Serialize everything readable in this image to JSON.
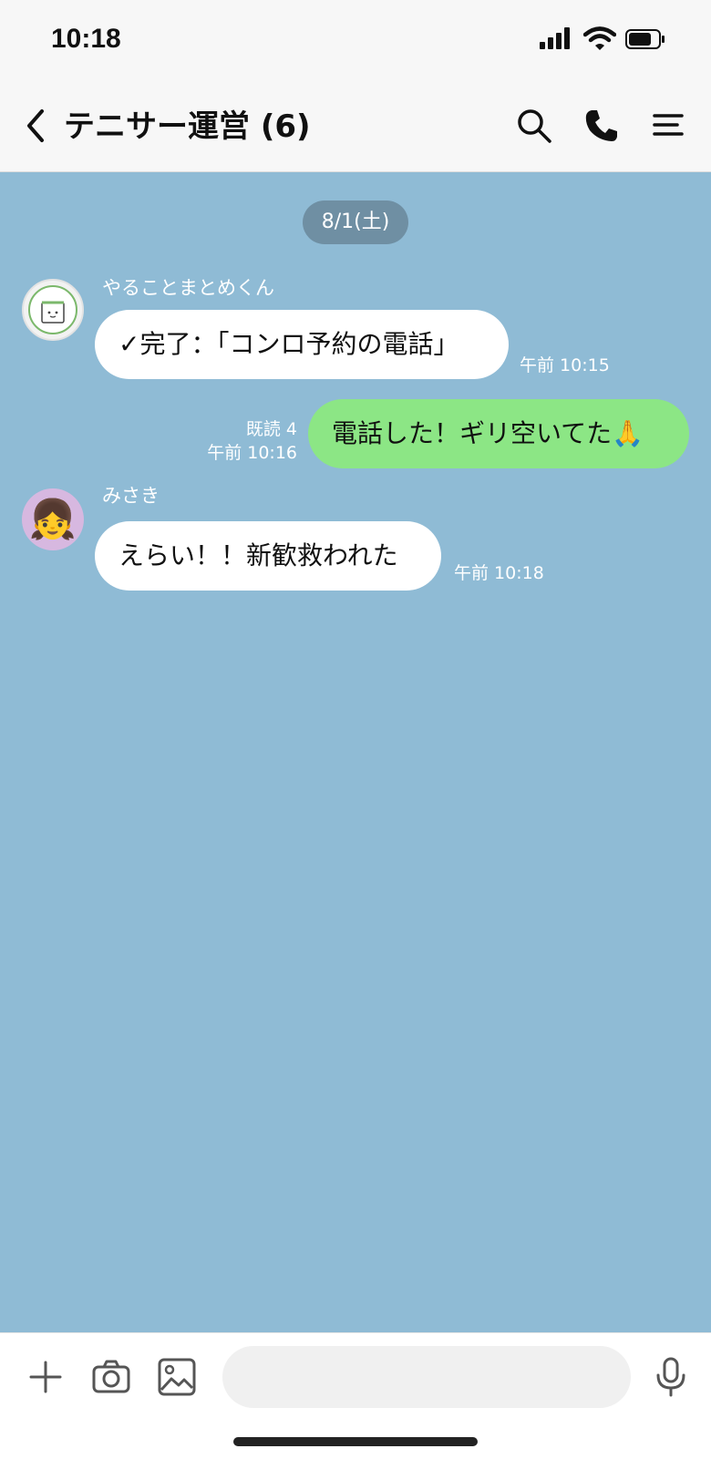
{
  "status_bar": {
    "time": "10:18"
  },
  "header": {
    "title": "テニサー運営 (6)",
    "icons": [
      "back-icon",
      "search-icon",
      "phone-icon",
      "menu-icon"
    ]
  },
  "chat": {
    "date_label": "8/1(土)",
    "messages": [
      {
        "direction": "incoming",
        "sender": "やることまとめくん",
        "avatar_text": "やることまとめくん",
        "text": "✓完了：「コンロ予約の電話」",
        "time": "午前 10:15"
      },
      {
        "direction": "outgoing",
        "read_receipt": "既読 4",
        "text": "電話した！ギリ空いてた🙏",
        "time": "午前 10:16"
      },
      {
        "direction": "incoming",
        "sender": "みさき",
        "avatar_emoji": "👧",
        "text": "えらい！！新歓救われた",
        "time": "午前 10:18"
      }
    ]
  },
  "input_bar": {
    "icons": [
      "plus-icon",
      "camera-icon",
      "image-icon",
      "mic-icon"
    ],
    "placeholder": ""
  },
  "colors": {
    "chat_background": "#8fbbd5",
    "outgoing_bubble": "#8ce685",
    "incoming_bubble": "#ffffff",
    "date_pill": "#6f8fa3"
  }
}
